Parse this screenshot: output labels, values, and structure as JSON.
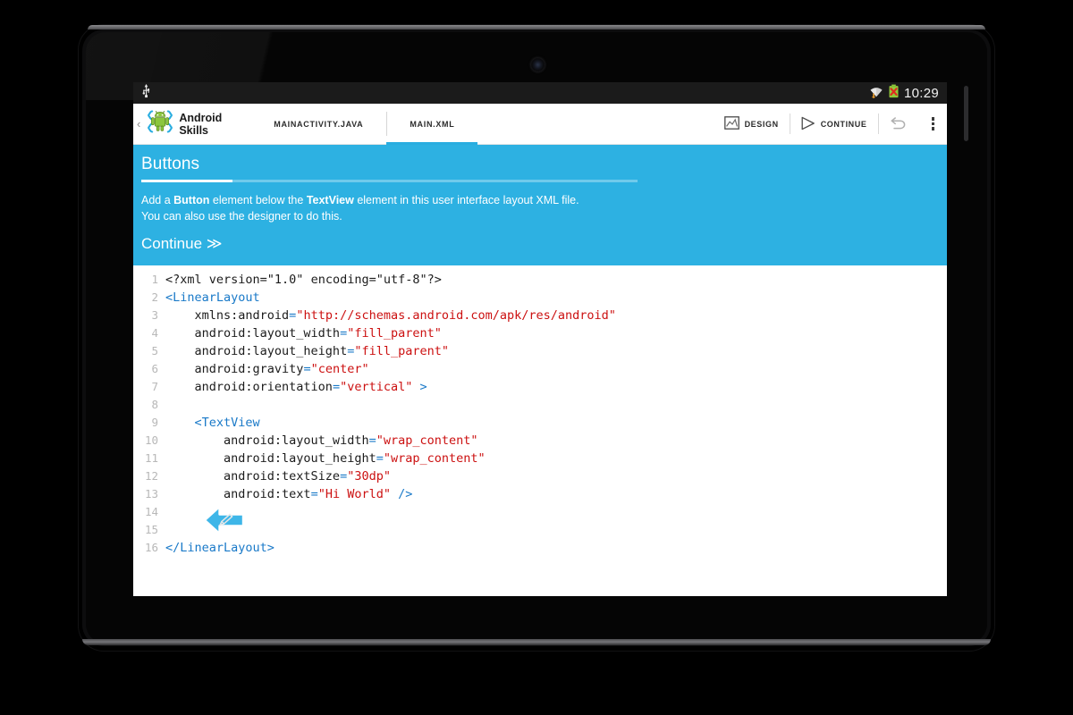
{
  "status_bar": {
    "usb_icon": "usb-icon",
    "wifi_icon": "wifi-icon",
    "battery_icon": "battery-error-icon",
    "clock": "10:29"
  },
  "action_bar": {
    "up_caret": "‹",
    "app_logo_icon": "android-robot-icon",
    "app_title": "Android\nSkills",
    "tabs": [
      {
        "label": "MAINACTIVITY.JAVA",
        "active": false
      },
      {
        "label": "MAIN.XML",
        "active": true
      }
    ],
    "actions": [
      {
        "label": "DESIGN",
        "icon": "image-icon"
      },
      {
        "label": "CONTINUE",
        "icon": "play-triangle-icon"
      },
      {
        "label": "",
        "icon": "undo-arrow-icon"
      }
    ],
    "overflow_icon": "overflow-menu-icon"
  },
  "instruction_panel": {
    "title": "Buttons",
    "body_part1": "Add a ",
    "body_bold1": "Button",
    "body_part2": " element below the ",
    "body_bold2": "TextView",
    "body_part3": " element in this user interface layout XML file.",
    "body_line2": "You can also use the designer to do this.",
    "continue_label": "Continue ≫",
    "accent_color": "#2db1e2"
  },
  "code_editor": {
    "edit_cursor_icon": "edit-here-arrow-icon",
    "lines": [
      {
        "number": "1",
        "tokens": [
          {
            "t": "<?xml version=",
            "c": "plain"
          },
          {
            "t": "\"1.0\"",
            "c": "plain"
          },
          {
            "t": " encoding=",
            "c": "plain"
          },
          {
            "t": "\"utf-8\"",
            "c": "plain"
          },
          {
            "t": "?>",
            "c": "plain"
          }
        ]
      },
      {
        "number": "2",
        "tokens": [
          {
            "t": "<LinearLayout",
            "c": "tag"
          }
        ]
      },
      {
        "number": "3",
        "tokens": [
          {
            "t": "    xmlns:android",
            "c": "plain"
          },
          {
            "t": "=",
            "c": "eq"
          },
          {
            "t": "\"http://schemas.android.com/apk/res/android\"",
            "c": "str"
          }
        ]
      },
      {
        "number": "4",
        "tokens": [
          {
            "t": "    android:layout_width",
            "c": "plain"
          },
          {
            "t": "=",
            "c": "eq"
          },
          {
            "t": "\"fill_parent\"",
            "c": "str"
          }
        ]
      },
      {
        "number": "5",
        "tokens": [
          {
            "t": "    android:layout_height",
            "c": "plain"
          },
          {
            "t": "=",
            "c": "eq"
          },
          {
            "t": "\"fill_parent\"",
            "c": "str"
          }
        ]
      },
      {
        "number": "6",
        "tokens": [
          {
            "t": "    android:gravity",
            "c": "plain"
          },
          {
            "t": "=",
            "c": "eq"
          },
          {
            "t": "\"center\"",
            "c": "str"
          }
        ]
      },
      {
        "number": "7",
        "tokens": [
          {
            "t": "    android:orientation",
            "c": "plain"
          },
          {
            "t": "=",
            "c": "eq"
          },
          {
            "t": "\"vertical\"",
            "c": "str"
          },
          {
            "t": " >",
            "c": "tag"
          }
        ]
      },
      {
        "number": "8",
        "tokens": [
          {
            "t": "",
            "c": "plain"
          }
        ]
      },
      {
        "number": "9",
        "tokens": [
          {
            "t": "    ",
            "c": "plain"
          },
          {
            "t": "<TextView",
            "c": "tag"
          }
        ]
      },
      {
        "number": "10",
        "tokens": [
          {
            "t": "        android:layout_width",
            "c": "plain"
          },
          {
            "t": "=",
            "c": "eq"
          },
          {
            "t": "\"wrap_content\"",
            "c": "str"
          }
        ]
      },
      {
        "number": "11",
        "tokens": [
          {
            "t": "        android:layout_height",
            "c": "plain"
          },
          {
            "t": "=",
            "c": "eq"
          },
          {
            "t": "\"wrap_content\"",
            "c": "str"
          }
        ]
      },
      {
        "number": "12",
        "tokens": [
          {
            "t": "        android:textSize",
            "c": "plain"
          },
          {
            "t": "=",
            "c": "eq"
          },
          {
            "t": "\"30dp\"",
            "c": "str"
          }
        ]
      },
      {
        "number": "13",
        "tokens": [
          {
            "t": "        android:text",
            "c": "plain"
          },
          {
            "t": "=",
            "c": "eq"
          },
          {
            "t": "\"Hi World\"",
            "c": "str"
          },
          {
            "t": " />",
            "c": "tag"
          }
        ]
      },
      {
        "number": "14",
        "tokens": [
          {
            "t": "",
            "c": "plain"
          }
        ]
      },
      {
        "number": "15",
        "tokens": [
          {
            "t": "",
            "c": "plain"
          }
        ]
      },
      {
        "number": "16",
        "tokens": [
          {
            "t": "</LinearLayout>",
            "c": "tag"
          }
        ]
      }
    ]
  }
}
